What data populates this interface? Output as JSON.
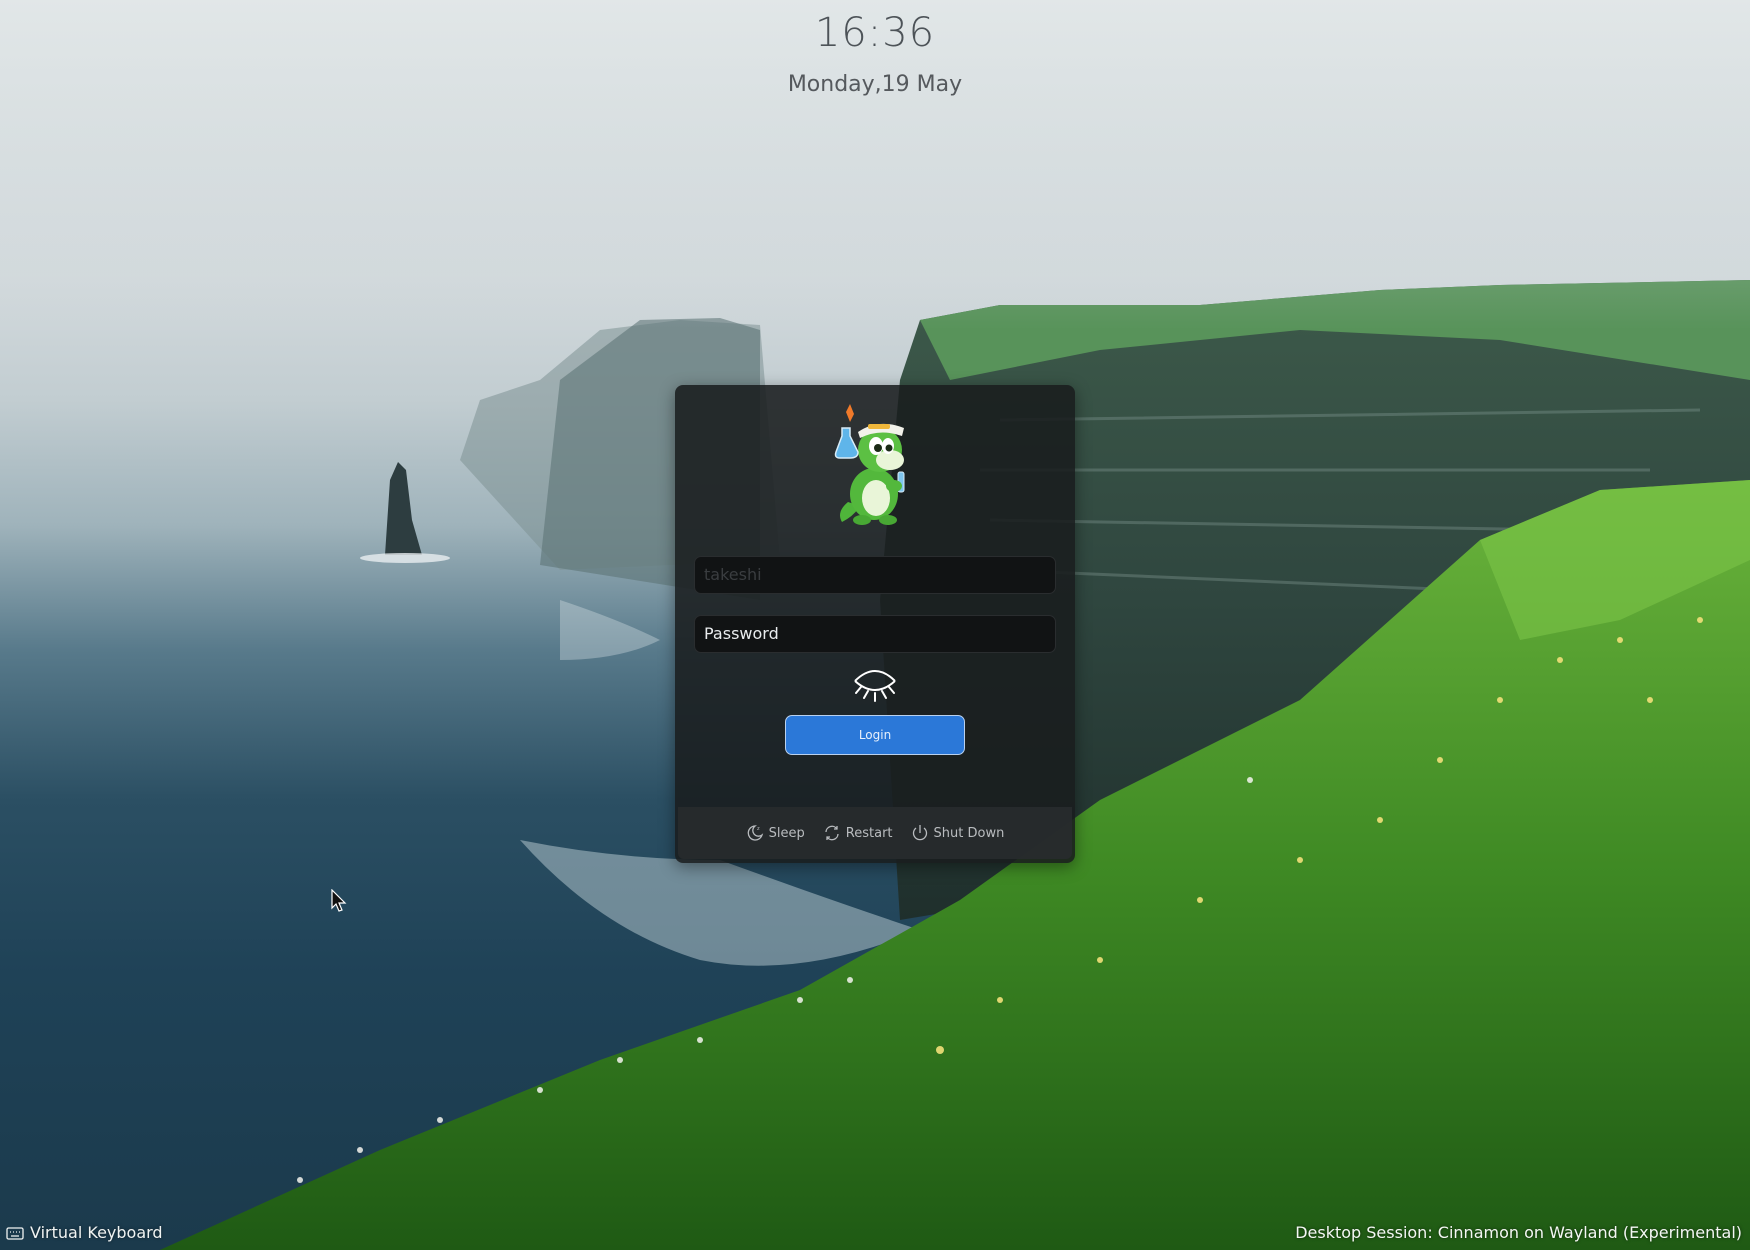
{
  "header": {
    "time": "16:36",
    "date": "Monday,19 May"
  },
  "login": {
    "username_value": "takeshi",
    "password_placeholder": "Password",
    "login_button": "Login",
    "mascot_icon": "konqi-mascot-icon",
    "show_password_icon": "eye-closed-icon"
  },
  "power": {
    "sleep": "Sleep",
    "restart": "Restart",
    "shutdown": "Shut Down"
  },
  "footer": {
    "virtual_keyboard": "Virtual Keyboard",
    "session": "Desktop Session: Cinnamon on Wayland (Experimental)"
  },
  "colors": {
    "accent": "#2b78d8",
    "panel_bg": "#1c1f21",
    "grass": "#4f9a2e",
    "sea": "#1f4257"
  }
}
